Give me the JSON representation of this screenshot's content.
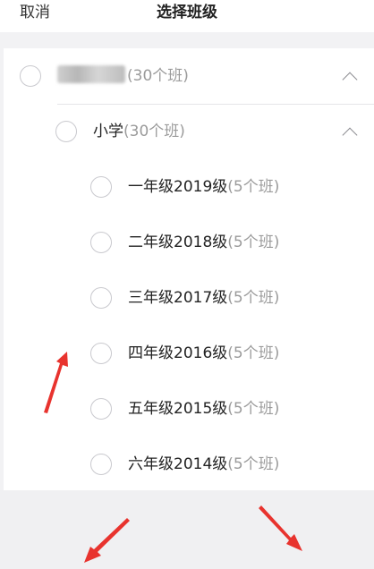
{
  "header": {
    "cancel_label": "取消",
    "title": "选择班级"
  },
  "school": {
    "name_redacted": true,
    "count": "(30个班)"
  },
  "section": {
    "name": "小学",
    "count": "(30个班)"
  },
  "grades": [
    {
      "name": "一年级2019级",
      "count": "(5个班)"
    },
    {
      "name": "二年级2018级",
      "count": "(5个班)"
    },
    {
      "name": "三年级2017级",
      "count": "(5个班)"
    },
    {
      "name": "四年级2016级",
      "count": "(5个班)"
    },
    {
      "name": "五年级2015级",
      "count": "(5个班)"
    },
    {
      "name": "六年级2014级",
      "count": "(5个班)"
    }
  ],
  "icons": {
    "radio": "radio-circle-icon",
    "chevron": "chevron-up-icon",
    "annotation_arrow": "red-arrow-icon"
  },
  "colors": {
    "annotation_red": "#e8332e",
    "footer_bg": "#f0f0f2",
    "count_text": "#9b9b9b"
  }
}
